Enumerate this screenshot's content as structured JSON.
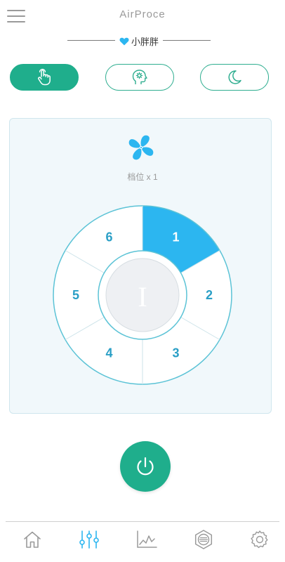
{
  "header": {
    "title": "AirProce"
  },
  "device": {
    "name": "小胖胖"
  },
  "modes": [
    {
      "name": "manual",
      "icon": "hand-pointer-icon",
      "active": true
    },
    {
      "name": "smart",
      "icon": "head-gear-icon",
      "active": false
    },
    {
      "name": "sleep",
      "icon": "moon-icon",
      "active": false
    }
  ],
  "panel": {
    "gear_label": "档位 x 1",
    "center_label": "I",
    "segments": [
      "1",
      "2",
      "3",
      "4",
      "5",
      "6"
    ],
    "selected_segment": "1"
  },
  "nav": [
    {
      "name": "home",
      "icon": "home-icon"
    },
    {
      "name": "controls",
      "icon": "sliders-icon"
    },
    {
      "name": "chart",
      "icon": "chart-line-icon"
    },
    {
      "name": "filter",
      "icon": "filter-icon"
    },
    {
      "name": "settings",
      "icon": "gear-icon"
    }
  ],
  "colors": {
    "accent_green": "#1fae8c",
    "accent_blue": "#2cb6f0",
    "ring_stroke": "#5cc3d6",
    "segment_text": "#2a9fc6"
  }
}
